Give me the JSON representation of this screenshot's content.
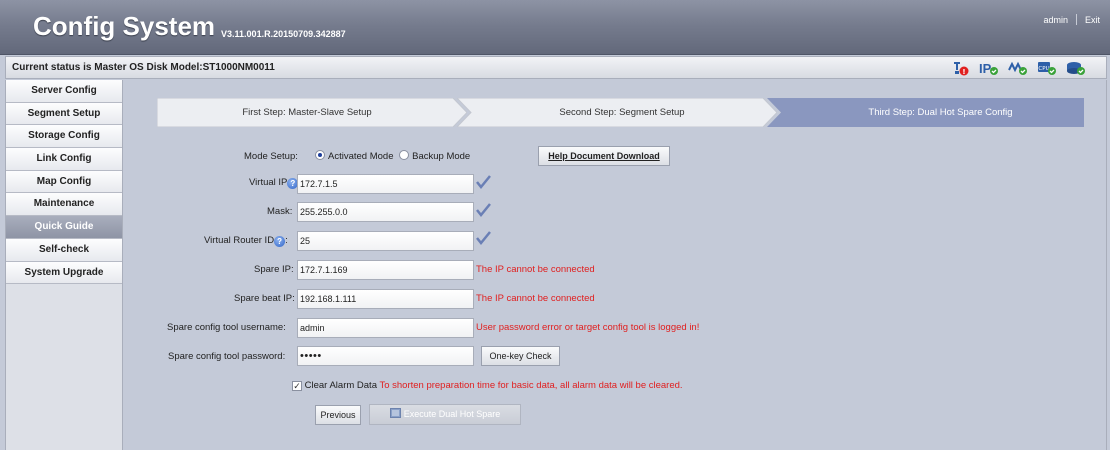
{
  "header": {
    "title": "Config System",
    "version": "V3.11.001.R.20150709.342887",
    "user": "admin",
    "exit": "Exit"
  },
  "status": {
    "text": "Current status is  Master OS Disk Model:ST1000NM0011",
    "icons": [
      "network-alarm-icon",
      "ip-status-icon",
      "link-status-icon",
      "cpu-icon",
      "disk-icon"
    ]
  },
  "sidebar": {
    "items": [
      {
        "label": "Server Config"
      },
      {
        "label": "Segment Setup"
      },
      {
        "label": "Storage Config"
      },
      {
        "label": "Link Config"
      },
      {
        "label": "Map Config"
      },
      {
        "label": "Maintenance"
      },
      {
        "label": "Quick Guide",
        "active": true
      },
      {
        "label": "Self-check"
      },
      {
        "label": "System Upgrade"
      }
    ]
  },
  "steps": [
    {
      "label": "First Step:  Master-Slave Setup"
    },
    {
      "label": "Second Step:  Segment Setup"
    },
    {
      "label": "Third Step:  Dual Hot Spare Config",
      "active": true
    }
  ],
  "form": {
    "mode_label": "Mode Setup:",
    "mode_activated": "Activated Mode",
    "mode_backup": "Backup Mode",
    "help_download": "Help Document Download",
    "virtual_ip_label": "Virtual IP",
    "virtual_ip": "172.7.1.5",
    "mask_label": "Mask:",
    "mask": "255.255.0.0",
    "vrid_label": "Virtual Router ID",
    "vrid": "25",
    "spare_ip_label": "Spare IP:",
    "spare_ip": "172.7.1.169",
    "spare_ip_error": "The IP cannot be connected",
    "spare_beat_label": "Spare beat IP:",
    "spare_beat_ip": "192.168.1.111",
    "spare_beat_error": "The IP cannot be connected",
    "username_label": "Spare config tool username:",
    "username": "admin",
    "username_error": "User password error or target config tool is logged in!",
    "password_label": "Spare config tool password:",
    "password": "•••••",
    "one_key_check": "One-key Check",
    "clear_alarm_label": "Clear Alarm Data",
    "clear_alarm_note": "To shorten preparation time for basic data, all alarm data will be cleared.",
    "previous": "Previous",
    "execute": "Execute Dual Hot Spare"
  },
  "colors": {
    "header": "#767c8e",
    "active_step": "#8a97bf",
    "error": "#e02020",
    "background": "#c4cad8"
  }
}
